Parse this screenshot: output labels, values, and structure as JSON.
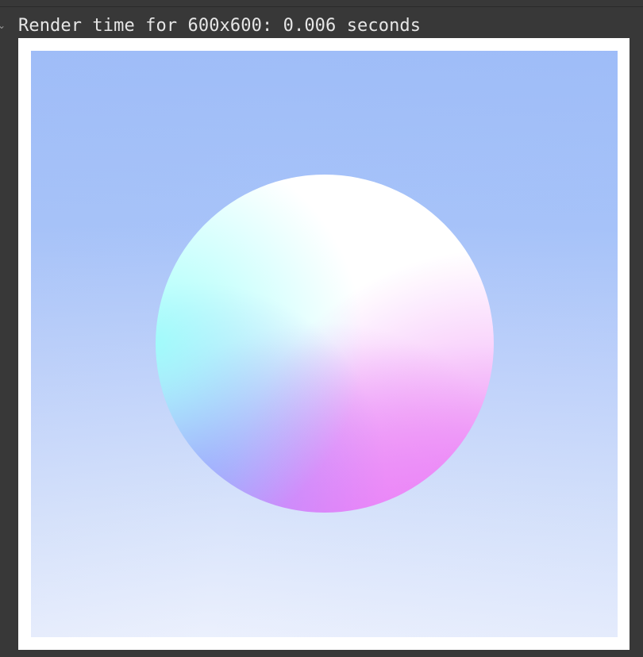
{
  "output": {
    "text": "Render time for 600x600: 0.006 seconds",
    "caret_glyph": "⌄"
  },
  "render": {
    "resolution": "600x600",
    "seconds": 0.006,
    "background_top_color": "#9fbdf8",
    "background_bottom_color": "#ebf0fd",
    "sphere_highlight_colors": [
      "#ffffff",
      "#9afff9",
      "#ee90fa",
      "#a99cff"
    ]
  }
}
